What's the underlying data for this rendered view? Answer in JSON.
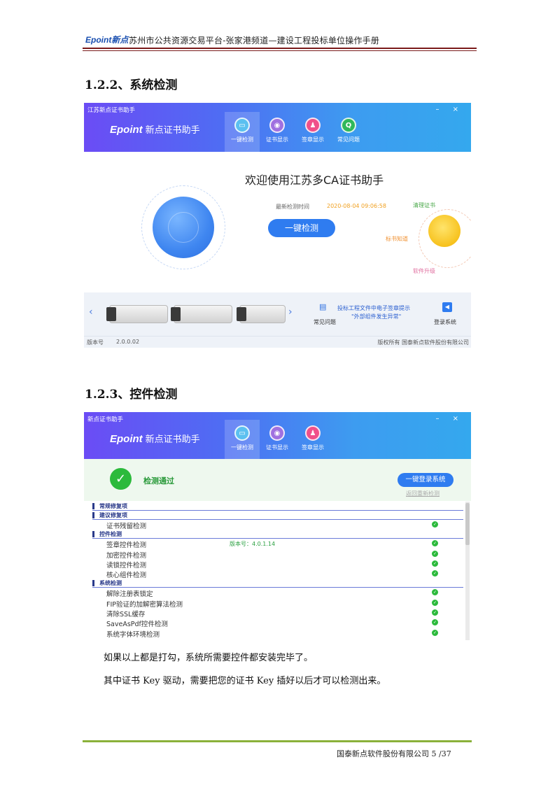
{
  "header": {
    "logo": "Epoint新点",
    "title": "苏州市公共资源交易平台-张家港频道—建设工程投标单位操作手册"
  },
  "section1": {
    "heading": "1.2.2、系统检测"
  },
  "app1": {
    "window_title": "江苏新点证书助手",
    "brand_logo": "Epoint",
    "brand_text": "新点证书助手",
    "nav": [
      "一键检测",
      "证书显示",
      "签章显示",
      "常见问题"
    ],
    "welcome": "欢迎使用江苏多CA证书助手",
    "last_check_label": "最新检测时间",
    "last_check_time": "2020-08-04 09:06:58",
    "one_click_button": "一键检测",
    "side_links": [
      "清理证书",
      "标书知道",
      "软件升级"
    ],
    "faq_label": "常见问题",
    "notice_line1": "投标工程文件中电子签章提示",
    "notice_line2": "\"外部组件发生异常\"",
    "login_label": "登录系统",
    "version_label": "版本号",
    "version": "2.0.0.02",
    "copyright": "版权所有  国泰新点软件股份有限公司",
    "colors": {
      "accent": "#2f7cf0",
      "time": "#f0a020"
    }
  },
  "section2": {
    "heading": "1.2.3、控件检测"
  },
  "app2": {
    "window_title": "新点证书助手",
    "brand_logo": "Epoint",
    "brand_text": "新点证书助手",
    "nav": [
      "一键检测",
      "证书显示",
      "签章显示"
    ],
    "pass_text": "检测通过",
    "login_button": "一键登录系统",
    "recheck_link": "返回重新检测",
    "categories": [
      {
        "name": "常规修复项",
        "items": []
      },
      {
        "name": "建议修复项",
        "items": [
          {
            "label": "证书残留检测",
            "version": ""
          }
        ]
      },
      {
        "name": "控件检测",
        "items": [
          {
            "label": "签章控件检测",
            "version": "版本号：4.0.1.14"
          },
          {
            "label": "加密控件检测",
            "version": ""
          },
          {
            "label": "读锁控件检测",
            "version": ""
          },
          {
            "label": "核心组件检测",
            "version": ""
          }
        ]
      },
      {
        "name": "系统检测",
        "items": [
          {
            "label": "解除注册表锁定",
            "version": ""
          },
          {
            "label": "FIP验证的加解密算法检测",
            "version": ""
          },
          {
            "label": "清除SSL缓存",
            "version": ""
          },
          {
            "label": "SaveAsPdf控件检测",
            "version": ""
          },
          {
            "label": "系统字体环境检测",
            "version": ""
          }
        ]
      }
    ]
  },
  "paragraphs": [
    "如果以上都是打勾，系统所需要控件都安装完毕了。",
    "其中证书 Key 驱动，需要把您的证书 Key 插好以后才可以检测出来。"
  ],
  "footer": {
    "text": "国泰新点软件股份有限公司 5 /37"
  }
}
